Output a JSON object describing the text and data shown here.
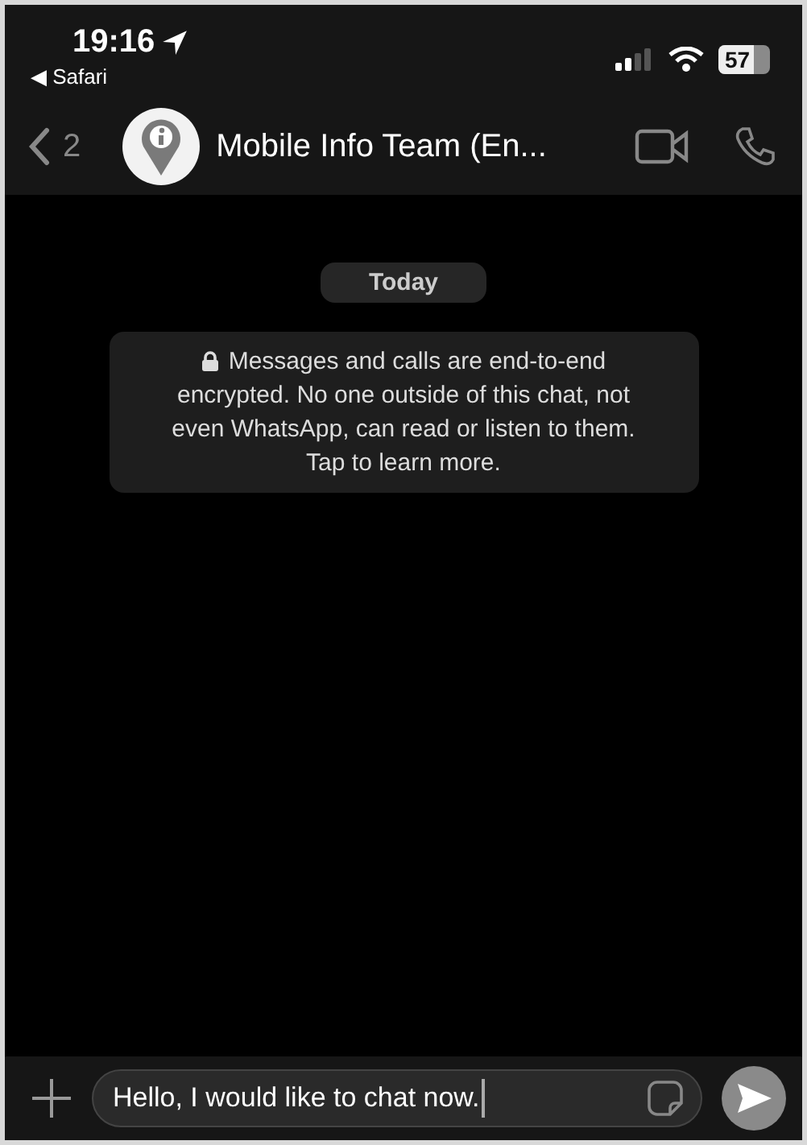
{
  "status_bar": {
    "time": "19:16",
    "back_app": "◀ Safari",
    "battery": "57"
  },
  "header": {
    "back_count": "2",
    "title": "Mobile Info Team (En..."
  },
  "chat": {
    "date": "Today",
    "notice_first_line": "Messages and calls are end-to-end",
    "notice_rest": "encrypted. No one outside of this chat, not even WhatsApp, can read or listen to them. Tap to learn more."
  },
  "composer": {
    "value": "Hello, I would like to chat now."
  }
}
